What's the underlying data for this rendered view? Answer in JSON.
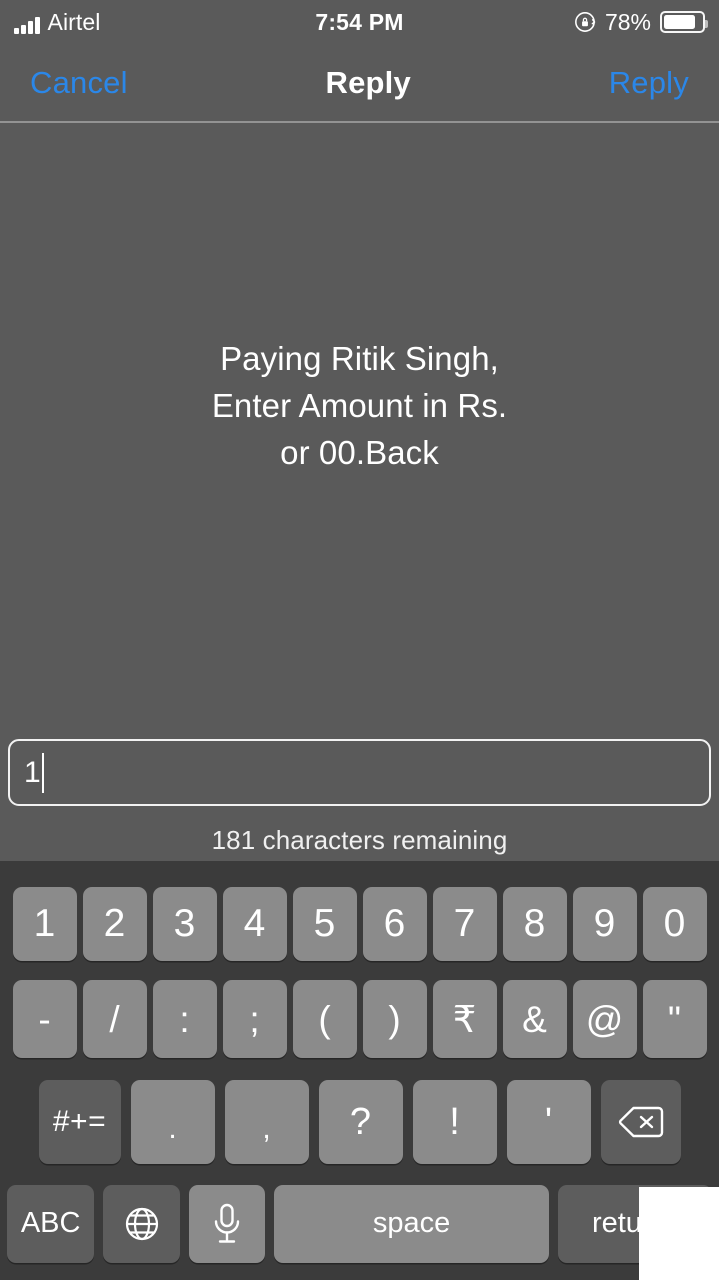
{
  "status_bar": {
    "carrier": "Airtel",
    "time": "7:54 PM",
    "battery_percent": "78%",
    "rotation_lock_icon": "rotation-lock-icon",
    "signal_icon": "signal-bars-icon",
    "battery_icon": "battery-icon",
    "battery_fill_ratio": 0.76
  },
  "nav_bar": {
    "cancel_label": "Cancel",
    "title": "Reply",
    "send_label": "Reply",
    "accent_color": "#2b87e8"
  },
  "message": {
    "text": "Paying Ritik  Singh,\nEnter Amount in Rs.\nor 00.Back"
  },
  "compose": {
    "input_value": "1",
    "input_placeholder": "",
    "counter_text": "181 characters remaining"
  },
  "keyboard": {
    "row1": [
      {
        "label": "1",
        "name": "key-1",
        "style": "light"
      },
      {
        "label": "2",
        "name": "key-2",
        "style": "light"
      },
      {
        "label": "3",
        "name": "key-3",
        "style": "light"
      },
      {
        "label": "4",
        "name": "key-4",
        "style": "light"
      },
      {
        "label": "5",
        "name": "key-5",
        "style": "light"
      },
      {
        "label": "6",
        "name": "key-6",
        "style": "light"
      },
      {
        "label": "7",
        "name": "key-7",
        "style": "light"
      },
      {
        "label": "8",
        "name": "key-8",
        "style": "light"
      },
      {
        "label": "9",
        "name": "key-9",
        "style": "light"
      },
      {
        "label": "0",
        "name": "key-0",
        "style": "light"
      }
    ],
    "row2": [
      {
        "label": "-",
        "name": "key-hyphen",
        "style": "light"
      },
      {
        "label": "/",
        "name": "key-slash",
        "style": "light"
      },
      {
        "label": ":",
        "name": "key-colon",
        "style": "light"
      },
      {
        "label": ";",
        "name": "key-semicolon",
        "style": "light"
      },
      {
        "label": "(",
        "name": "key-open-paren",
        "style": "light"
      },
      {
        "label": ")",
        "name": "key-close-paren",
        "style": "light"
      },
      {
        "label": "₹",
        "name": "key-rupee",
        "style": "light"
      },
      {
        "label": "&",
        "name": "key-ampersand",
        "style": "light"
      },
      {
        "label": "@",
        "name": "key-at",
        "style": "light"
      },
      {
        "label": "\"",
        "name": "key-quote",
        "style": "light"
      }
    ],
    "row3": {
      "symbols_label": "#+=",
      "keys": [
        {
          "label": ".",
          "name": "key-period",
          "style": "light"
        },
        {
          "label": ",",
          "name": "key-comma",
          "style": "light"
        },
        {
          "label": "?",
          "name": "key-question",
          "style": "light"
        },
        {
          "label": "!",
          "name": "key-exclamation",
          "style": "light"
        },
        {
          "label": "'",
          "name": "key-apostrophe",
          "style": "light"
        }
      ],
      "delete_icon": "backspace-icon"
    },
    "row4": {
      "abc_label": "ABC",
      "globe_icon": "globe-icon",
      "mic_icon": "microphone-icon",
      "space_label": "space",
      "return_label": "return"
    }
  },
  "colors": {
    "background": "#5a5a5a",
    "keyboard_background": "#3b3b3b",
    "key_light": "#8b8b8b",
    "key_dark": "#5d5d5d",
    "accent_blue": "#2b87e8",
    "text_white": "#ffffff",
    "overlay_patch": "#ffffff"
  }
}
